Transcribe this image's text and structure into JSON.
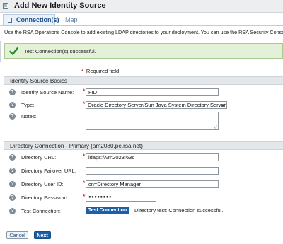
{
  "title": "Add New Identity Source",
  "tabs": [
    {
      "label": "Connection(s)",
      "active": true
    },
    {
      "label": "Map",
      "active": false
    }
  ],
  "intro_text": "Use the RSA Operations Console to add existing LDAP directories to your deployment. You can use the RSA Security Console to v",
  "success_message": "Test Connection(s) successful.",
  "required_note": "Required field",
  "basics": {
    "section_title": "Identity Source Basics",
    "name_label": "Identity Source Name:",
    "name_value": "FID",
    "type_label": "Type:",
    "type_value": "Oracle Directory Server/Sun Java System Directory Server",
    "notes_label": "Notes:",
    "notes_value": ""
  },
  "directory": {
    "section_title": "Directory Connection - Primary (am2080.pe.rsa.net)",
    "url_label": "Directory URL:",
    "url_value": "ldaps://vm2023:636",
    "failover_label": "Directory Failover URL:",
    "failover_value": "",
    "user_label": "Directory User ID:",
    "user_value": "cn=Directory Manager",
    "password_label": "Directory Password:",
    "password_value": "●●●●●●●●",
    "test_label": "Test Connection:",
    "test_button": "Test Connection",
    "test_result": "Directory test: Connection successful."
  },
  "footer": {
    "cancel_label": "Cancel",
    "next_label": "Next"
  },
  "colors": {
    "accent": "#1d5fa6",
    "success_bg": "#e3f1d8",
    "required": "#cc0000"
  },
  "icons": {
    "title": "page-icon",
    "tab": "connection-icon",
    "success": "checkmark-icon",
    "help": "help-icon",
    "select": "chevron-down-icon"
  }
}
